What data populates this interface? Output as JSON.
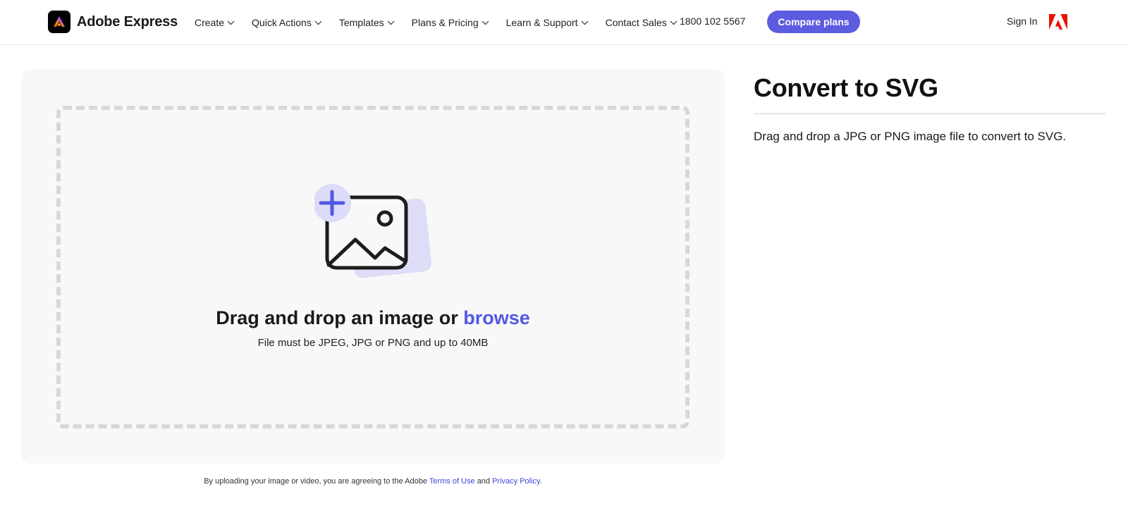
{
  "header": {
    "brand_name": "Adobe Express",
    "nav": [
      {
        "label": "Create"
      },
      {
        "label": "Quick Actions"
      },
      {
        "label": "Templates"
      },
      {
        "label": "Plans & Pricing"
      },
      {
        "label": "Learn & Support"
      },
      {
        "label": "Contact Sales"
      }
    ],
    "phone": "1800 102 5567",
    "cta_label": "Compare plans",
    "signin_label": "Sign In"
  },
  "upload": {
    "title_prefix": "Drag and drop an image or ",
    "browse_label": "browse",
    "subtitle": "File must be JPEG, JPG or PNG and up to 40MB"
  },
  "legal": {
    "prefix": "By uploading your image or video, you are agreeing to the Adobe ",
    "terms_label": "Terms of Use",
    "and_text": " and ",
    "privacy_label": "Privacy Policy",
    "suffix": "."
  },
  "page": {
    "title": "Convert to SVG",
    "description": "Drag and drop a JPG or PNG image file to convert to SVG."
  },
  "colors": {
    "accent": "#5c5ce0",
    "link": "#5258e4",
    "adobe_red": "#eb1000"
  },
  "icons": {
    "brand": "adobe-express-logo",
    "chevron": "chevron-down-icon",
    "adobe": "adobe-logo-icon",
    "upload": "image-add-icon"
  }
}
